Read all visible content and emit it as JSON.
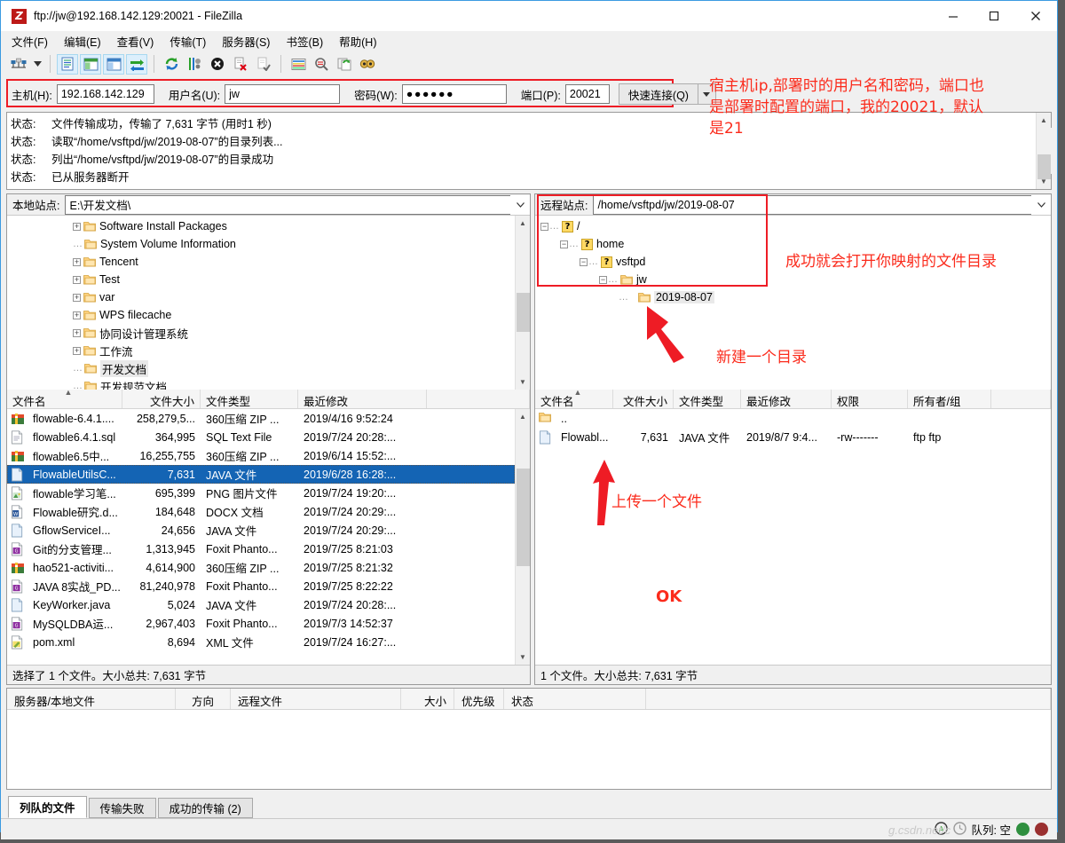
{
  "window": {
    "title": "ftp://jw@192.168.142.129:20021 - FileZilla",
    "logo_text": "Z",
    "minimize": "—",
    "maximize": "☐",
    "close": "✕"
  },
  "menu": [
    {
      "label": "文件(F)"
    },
    {
      "label": "编辑(E)"
    },
    {
      "label": "查看(V)"
    },
    {
      "label": "传输(T)"
    },
    {
      "label": "服务器(S)"
    },
    {
      "label": "书签(B)"
    },
    {
      "label": "帮助(H)"
    }
  ],
  "toolbar": {
    "icons": [
      "site-manager-icon",
      "site-manager-dropdown-icon",
      "toggle-message-log-icon",
      "toggle-local-tree-icon",
      "toggle-remote-tree-icon",
      "toggle-transfer-queue-icon",
      "refresh-icon",
      "process-queue-icon",
      "cancel-icon",
      "disconnect-icon",
      "reconnect-icon",
      "filter-icon",
      "directory-compare-icon",
      "synchronized-browsing-icon",
      "find-files-icon"
    ]
  },
  "quickconnect": {
    "host_label": "主机(H):",
    "host_value": "192.168.142.129",
    "user_label": "用户名(U):",
    "user_value": "jw",
    "pass_label": "密码(W):",
    "pass_value": "●●●●●●",
    "port_label": "端口(P):",
    "port_value": "20021",
    "connect_label": "快速连接(Q)",
    "dropdown_icon": "chevron-down-icon"
  },
  "log": {
    "key": "状态:",
    "lines": [
      "文件传输成功，传输了 7,631 字节 (用时1 秒)",
      "读取“/home/vsftpd/jw/2019-08-07”的目录列表...",
      "列出“/home/vsftpd/jw/2019-08-07”的目录成功",
      "已从服务器断开"
    ]
  },
  "annotations": {
    "connection": "宿主机ip,部署时的用户名和密码，端口也\n是部署时配置的端口，我的20021，默认\n是21",
    "remote_tree": "成功就会打开你映射的文件目录",
    "new_directory": "新建一个目录",
    "upload_file": "上传一个文件",
    "ok": "OK"
  },
  "local": {
    "site_label": "本地站点:",
    "site_value": "E:\\开发文档\\",
    "dropdown_icon": "chevron-down-icon",
    "tree": [
      {
        "label": "Software Install Packages",
        "expandable": true,
        "indent": 2,
        "selected": false
      },
      {
        "label": "System Volume Information",
        "expandable": false,
        "indent": 2,
        "selected": false
      },
      {
        "label": "Tencent",
        "expandable": true,
        "indent": 2,
        "selected": false
      },
      {
        "label": "Test",
        "expandable": true,
        "indent": 2,
        "selected": false
      },
      {
        "label": "var",
        "expandable": true,
        "indent": 2,
        "selected": false
      },
      {
        "label": "WPS filecache",
        "expandable": true,
        "indent": 2,
        "selected": false
      },
      {
        "label": "协同设计管理系统",
        "expandable": true,
        "indent": 2,
        "selected": false
      },
      {
        "label": "工作流",
        "expandable": true,
        "indent": 2,
        "selected": false
      },
      {
        "label": "开发文档",
        "expandable": false,
        "indent": 2,
        "selected": true
      },
      {
        "label": "开发规范文档",
        "expandable": false,
        "indent": 2,
        "selected": false
      }
    ],
    "columns": [
      "文件名",
      "文件大小",
      "文件类型",
      "最近修改"
    ],
    "rows": [
      {
        "icon": "archive-icon",
        "name": "flowable-6.4.1....",
        "size": "258,279,5...",
        "type": "360压缩 ZIP ...",
        "modified": "2019/4/16 9:52:24",
        "selected": false
      },
      {
        "icon": "sql-file-icon",
        "name": "flowable6.4.1.sql",
        "size": "364,995",
        "type": "SQL Text File",
        "modified": "2019/7/24 20:28:...",
        "selected": false
      },
      {
        "icon": "archive-icon",
        "name": "flowable6.5中...",
        "size": "16,255,755",
        "type": "360压缩 ZIP ...",
        "modified": "2019/6/14 15:52:...",
        "selected": false
      },
      {
        "icon": "java-file-icon",
        "name": "FlowableUtilsC...",
        "size": "7,631",
        "type": "JAVA 文件",
        "modified": "2019/6/28 16:28:...",
        "selected": true
      },
      {
        "icon": "png-file-icon",
        "name": "flowable学习笔...",
        "size": "695,399",
        "type": "PNG 图片文件",
        "modified": "2019/7/24 19:20:...",
        "selected": false
      },
      {
        "icon": "docx-file-icon",
        "name": "Flowable研究.d...",
        "size": "184,648",
        "type": "DOCX 文档",
        "modified": "2019/7/24 20:29:...",
        "selected": false
      },
      {
        "icon": "java-file-icon",
        "name": "GflowServiceI...",
        "size": "24,656",
        "type": "JAVA 文件",
        "modified": "2019/7/24 20:29:...",
        "selected": false
      },
      {
        "icon": "pdf-file-icon",
        "name": "Git的分支管理...",
        "size": "1,313,945",
        "type": "Foxit Phanto...",
        "modified": "2019/7/25 8:21:03",
        "selected": false
      },
      {
        "icon": "archive-icon",
        "name": "hao521-activiti...",
        "size": "4,614,900",
        "type": "360压缩 ZIP ...",
        "modified": "2019/7/25 8:21:32",
        "selected": false
      },
      {
        "icon": "pdf-file-icon",
        "name": "JAVA 8实战_PD...",
        "size": "81,240,978",
        "type": "Foxit Phanto...",
        "modified": "2019/7/25 8:22:22",
        "selected": false
      },
      {
        "icon": "java-file-icon",
        "name": "KeyWorker.java",
        "size": "5,024",
        "type": "JAVA 文件",
        "modified": "2019/7/24 20:28:...",
        "selected": false
      },
      {
        "icon": "pdf-file-icon",
        "name": "MySQLDBA运...",
        "size": "2,967,403",
        "type": "Foxit Phanto...",
        "modified": "2019/7/3 14:52:37",
        "selected": false
      },
      {
        "icon": "xml-file-icon",
        "name": "pom.xml",
        "size": "8,694",
        "type": "XML 文件",
        "modified": "2019/7/24 16:27:...",
        "selected": false
      }
    ],
    "status": "选择了 1 个文件。大小总共: 7,631 字节"
  },
  "remote": {
    "site_label": "远程站点:",
    "site_value": "/home/vsftpd/jw/2019-08-07",
    "dropdown_icon": "chevron-down-icon",
    "tree": [
      {
        "label": "/",
        "icon": "question-icon",
        "indent": 0,
        "expandable": true,
        "selected": false
      },
      {
        "label": "home",
        "icon": "question-icon",
        "indent": 1,
        "expandable": true,
        "selected": false
      },
      {
        "label": "vsftpd",
        "icon": "question-icon",
        "indent": 2,
        "expandable": true,
        "selected": false
      },
      {
        "label": "jw",
        "icon": "folder-icon",
        "indent": 3,
        "expandable": true,
        "selected": false
      },
      {
        "label": "2019-08-07",
        "icon": "folder-icon",
        "indent": 4,
        "expandable": false,
        "selected": true
      }
    ],
    "columns": [
      "文件名",
      "文件大小",
      "文件类型",
      "最近修改",
      "权限",
      "所有者/组"
    ],
    "rows": [
      {
        "icon": "folder-icon",
        "name": "..",
        "size": "",
        "type": "",
        "modified": "",
        "perms": "",
        "owner": ""
      },
      {
        "icon": "java-file-icon",
        "name": "Flowabl...",
        "size": "7,631",
        "type": "JAVA 文件",
        "modified": "2019/8/7 9:4...",
        "perms": "-rw-------",
        "owner": "ftp ftp"
      }
    ],
    "status": "1 个文件。大小总共: 7,631 字节"
  },
  "queue": {
    "columns": [
      "服务器/本地文件",
      "方向",
      "远程文件",
      "大小",
      "优先级",
      "状态"
    ]
  },
  "tabs": [
    {
      "label": "列队的文件",
      "active": true
    },
    {
      "label": "传输失败",
      "active": false
    },
    {
      "label": "成功的传输 (2)",
      "active": false
    }
  ],
  "statusbar": {
    "queue_label": "队列: 空",
    "watermark": "g.csdn.net/c",
    "icons": [
      "tls-icon",
      "speed-icon",
      "transfer-green-icon",
      "transfer-red-icon"
    ]
  },
  "colors": {
    "accent_red": "#ee1c25",
    "selection_blue": "#1464b4",
    "title_border": "#3b9ae1",
    "folder_yellow": "#ffd27f"
  }
}
